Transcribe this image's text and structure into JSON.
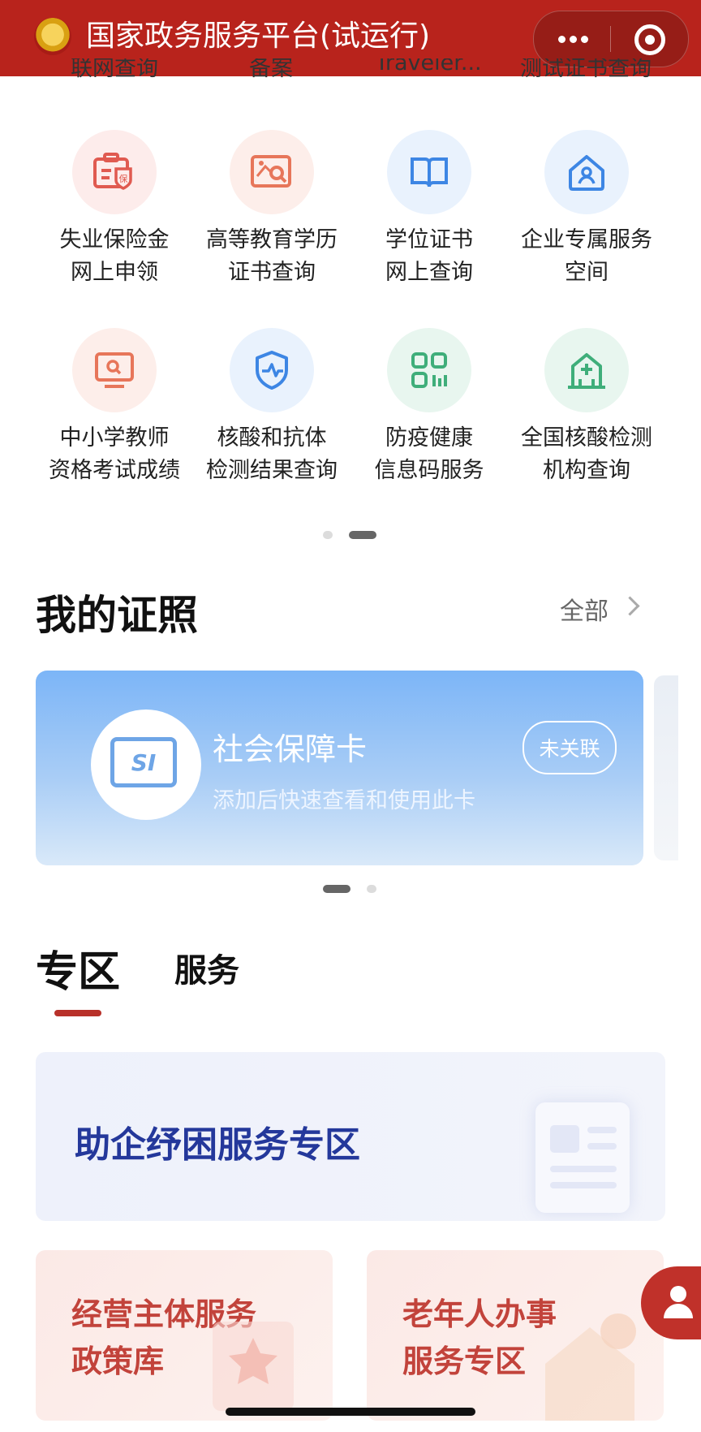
{
  "app": {
    "title": "国家政务服务平台(试运行)"
  },
  "top_row_clipped": [
    "联网查询",
    "备案",
    "Traveler...",
    "测试证书查询"
  ],
  "services": [
    {
      "label_line1": "失业保险金",
      "label_line2": "网上申领",
      "icon": "insurance-card-icon"
    },
    {
      "label_line1": "高等教育学历",
      "label_line2": "证书查询",
      "icon": "certificate-search-icon"
    },
    {
      "label_line1": "学位证书",
      "label_line2": "网上查询",
      "icon": "book-icon"
    },
    {
      "label_line1": "企业专属服务",
      "label_line2": "空间",
      "icon": "enterprise-home-icon"
    },
    {
      "label_line1": "中小学教师",
      "label_line2": "资格考试成绩",
      "icon": "monitor-search-icon"
    },
    {
      "label_line1": "核酸和抗体",
      "label_line2": "检测结果查询",
      "icon": "shield-pulse-icon"
    },
    {
      "label_line1": "防疫健康",
      "label_line2": "信息码服务",
      "icon": "qr-code-icon"
    },
    {
      "label_line1": "全国核酸检测",
      "label_line2": "机构查询",
      "icon": "hospital-icon"
    }
  ],
  "licenses": {
    "title": "我的证照",
    "view_all": "全部",
    "card": {
      "logo_text": "SI",
      "title": "社会保障卡",
      "subtitle": "添加后快速查看和使用此卡",
      "badge": "未关联"
    }
  },
  "tabs": [
    {
      "label": "专区",
      "active": true
    },
    {
      "label": "服务",
      "active": false
    }
  ],
  "zone_banner": {
    "title": "助企纾困服务专区"
  },
  "zone_tiles": [
    {
      "title": "经营主体服务\n政策库"
    },
    {
      "title": "老年人办事\n服务专区"
    }
  ],
  "colors": {
    "brand_red": "#b8231c",
    "accent_blue": "#24389b"
  }
}
